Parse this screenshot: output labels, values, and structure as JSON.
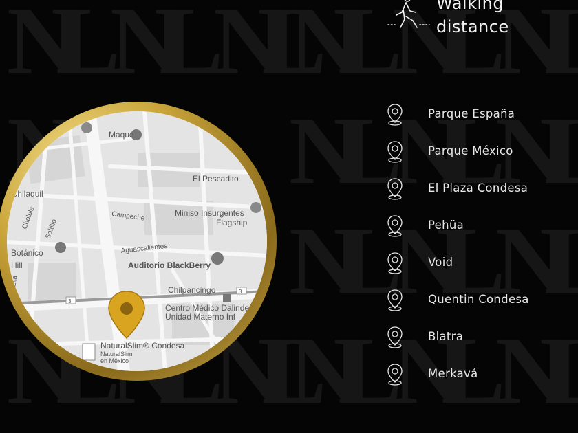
{
  "header": {
    "line1": "Walking",
    "line2": "distance"
  },
  "map": {
    "labels": {
      "maque": "Maque",
      "el_pescadito": "El Pescadito",
      "el_chilaquil": "el Chilaquil",
      "cholula": "Cholula",
      "saltillo": "Saltillo",
      "campeche": "Campeche",
      "miniso_1": "Miniso Insurgentes",
      "miniso_2": "Flagship",
      "aguascalientes": "Aguascalientes",
      "botanico": "Botánico",
      "auditorio": "Auditorio BlackBerry",
      "in_hill": "n Hill",
      "ella": "Ella",
      "chilpancingo": "Chilpancingo",
      "route_3a": "3",
      "route_3b": "3",
      "centro_medico_1": "Centro Médico Dalinde",
      "centro_medico_2": "Unidad Materno Inf",
      "naturalslim": "NaturalSlim® Condesa",
      "naturalslim_sub1": "NaturalSlim",
      "naturalslim_sub2": "en México"
    },
    "colors": {
      "pin": "#d9a520",
      "ring": "#c9a43a"
    }
  },
  "places": [
    {
      "name": "Parque España"
    },
    {
      "name": "Parque México"
    },
    {
      "name": "El Plaza Condesa"
    },
    {
      "name": "Pehüa"
    },
    {
      "name": "Void"
    },
    {
      "name": "Quentin Condesa"
    },
    {
      "name": "Blatra"
    },
    {
      "name": "Merkavá"
    }
  ]
}
